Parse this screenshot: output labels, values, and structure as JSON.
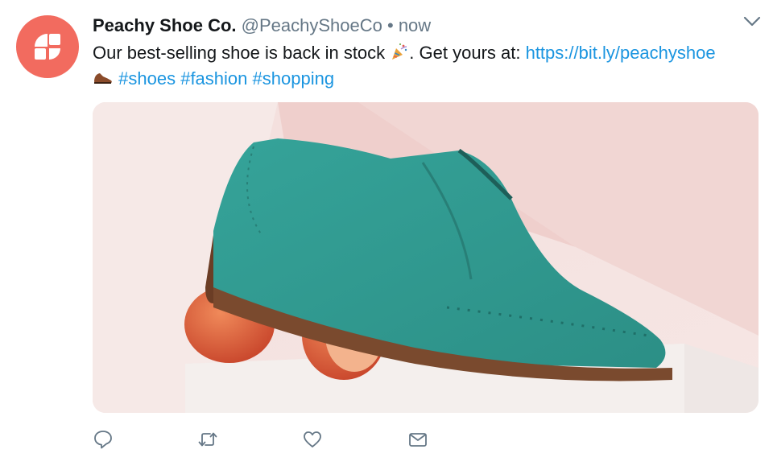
{
  "colors": {
    "avatar_bg": "#f26b5f",
    "name": "#14171a",
    "muted": "#657786",
    "link": "#1b95e0",
    "icon": "#657786",
    "shoe": "#3aa39a"
  },
  "tweet": {
    "display_name": "Peachy Shoe Co.",
    "handle": "@PeachyShoeCo",
    "separator": "•",
    "time": "now",
    "text_before_emoji": "Our best-selling shoe is back in stock",
    "text_after_emoji": ". Get yours at: ",
    "url": "https://bit.ly/peachyshoe",
    "hashtags": [
      "#shoes",
      "#fashion",
      "#shopping"
    ],
    "emojis": [
      "party-popper-icon",
      "shoe-icon"
    ]
  },
  "media": {
    "type": "photo",
    "subject": "teal suede brogue shoe resting on peach halves"
  },
  "actions": [
    {
      "name": "reply",
      "icon": "reply-icon"
    },
    {
      "name": "retweet",
      "icon": "retweet-icon"
    },
    {
      "name": "like",
      "icon": "heart-icon"
    },
    {
      "name": "direct-message",
      "icon": "envelope-icon"
    }
  ]
}
